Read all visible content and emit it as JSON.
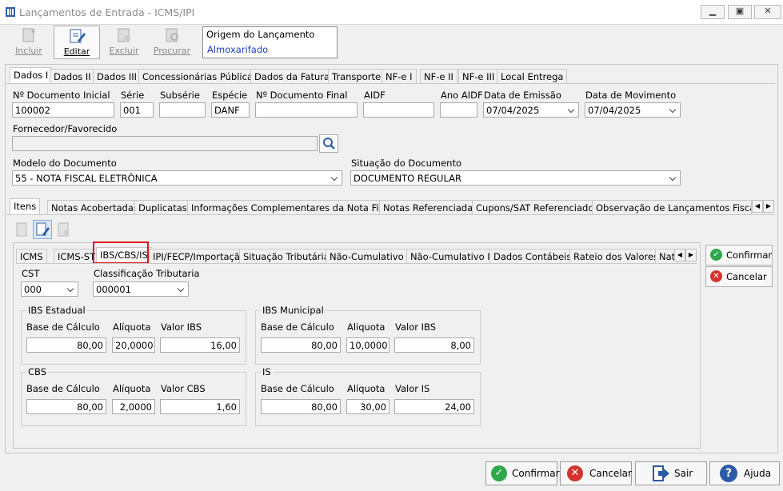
{
  "window": {
    "title": "Lançamentos de Entrada - ICMS/IPI"
  },
  "toolbar": {
    "incluir": "Incluir",
    "editar": "Editar",
    "excluir": "Excluir",
    "procurar": "Procurar"
  },
  "origem": {
    "label": "Origem do Lançamento",
    "value": "Almoxarifado"
  },
  "tabs_top": [
    "Dados I",
    "Dados II",
    "Dados III",
    "Concessionárias Públicas",
    "Dados da Fatura",
    "Transporte",
    "NF-e I",
    "NF-e II",
    "NF-e III",
    "Local Entrega"
  ],
  "form": {
    "doc_inicial_label": "Nº Documento Inicial",
    "doc_inicial": "100002",
    "serie_label": "Série",
    "serie": "001",
    "subserie_label": "Subsérie",
    "subserie": "",
    "especie_label": "Espécie",
    "especie": "DANF",
    "doc_final_label": "Nº Documento Final",
    "doc_final": "",
    "aidf_label": "AIDF",
    "aidf": "",
    "ano_aidf_label": "Ano AIDF",
    "ano_aidf": "",
    "data_emissao_label": "Data de Emissão",
    "data_emissao": "07/04/2025",
    "data_mov_label": "Data de Movimento",
    "data_mov": "07/04/2025",
    "fornecedor_label": "Fornecedor/Favorecido",
    "fornecedor": "",
    "modelo_label": "Modelo do Documento",
    "modelo": "55 - NOTA FISCAL ELETRÔNICA",
    "situacao_label": "Situação do Documento",
    "situacao": "DOCUMENTO REGULAR"
  },
  "tabs_mid": [
    "Itens",
    "Notas Acobertadas",
    "Duplicatas",
    "Informações Complementares da Nota Fiscal",
    "Notas Referenciadas",
    "Cupons/SAT Referenciados",
    "Observação de Lançamentos Fiscais (C"
  ],
  "tabs_inner": [
    "ICMS",
    "ICMS-ST",
    "IBS/CBS/IS",
    "IPI/FECP/Importação",
    "Situação Tributária",
    "Não-Cumulativo I",
    "Não-Cumulativo II",
    "Dados Contábeis",
    "Rateio dos Valores",
    "Nat"
  ],
  "tax": {
    "cst_label": "CST",
    "cst": "000",
    "class_label": "Classificação Tributaria",
    "class": "000001",
    "ibs_est": {
      "title": "IBS Estadual",
      "base_label": "Base de Cálculo",
      "aliq_label": "Alíquota",
      "valor_label": "Valor IBS",
      "base": "80,00",
      "aliq": "20,0000",
      "valor": "16,00"
    },
    "ibs_mun": {
      "title": "IBS Municipal",
      "base_label": "Base de Cálculo",
      "aliq_label": "Aliquota",
      "valor_label": "Valor IBS",
      "base": "80,00",
      "aliq": "10,0000",
      "valor": "8,00"
    },
    "cbs": {
      "title": "CBS",
      "base_label": "Base de Cálculo",
      "aliq_label": "Alíquota",
      "valor_label": "Valor CBS",
      "base": "80,00",
      "aliq": "2,0000",
      "valor": "1,60"
    },
    "is": {
      "title": "IS",
      "base_label": "Base de Cálculo",
      "aliq_label": "Alíquota",
      "valor_label": "Valor IS",
      "base": "80,00",
      "aliq": "30,00",
      "valor": "24,00"
    }
  },
  "side": {
    "confirmar": "Confirmar",
    "cancelar": "Cancelar"
  },
  "bottom": {
    "confirmar": "Confirmar",
    "cancelar": "Cancelar",
    "sair": "Sair",
    "ajuda": "Ajuda"
  },
  "colors": {
    "highlight": "#e0151b",
    "link": "#1f3fbf",
    "ok": "#2da84a",
    "cancel": "#d6322f",
    "help": "#2b5aa6"
  }
}
